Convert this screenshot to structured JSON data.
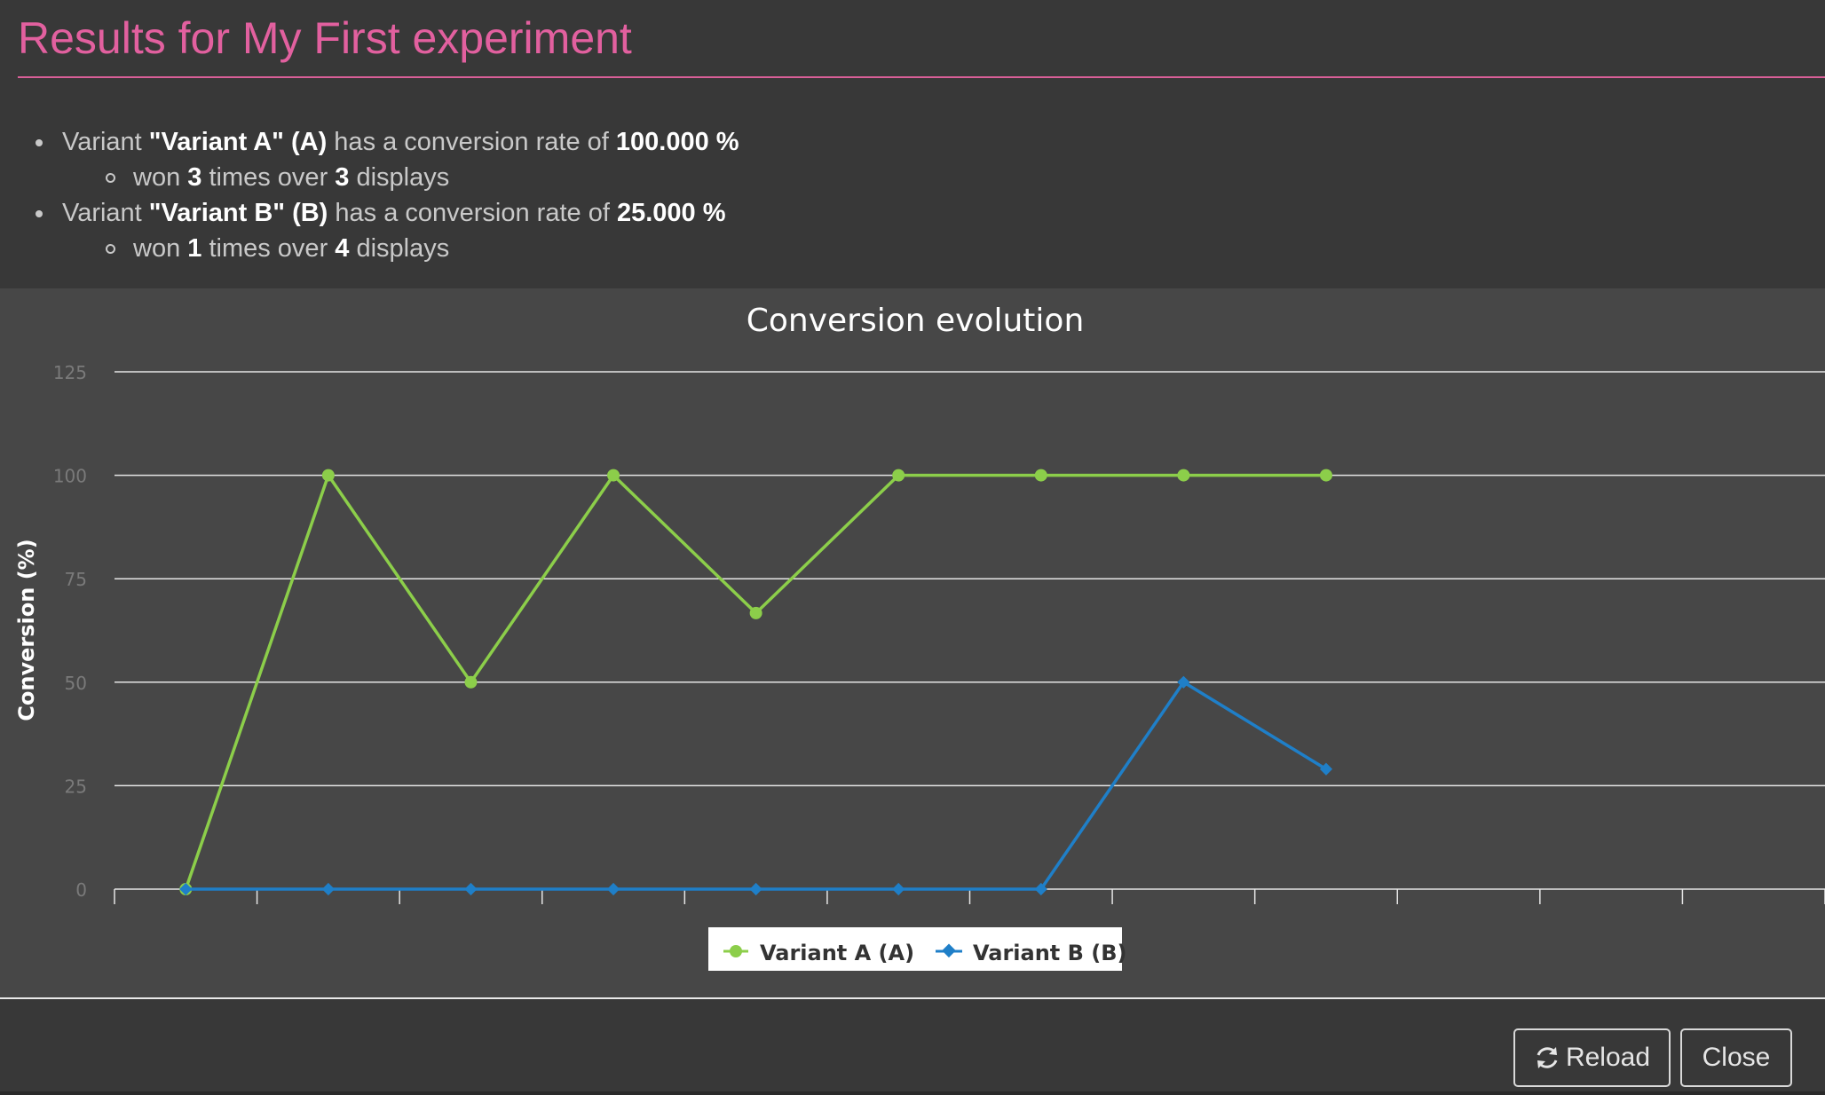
{
  "modal": {
    "title": "Results for My First experiment"
  },
  "summary": {
    "variants": [
      {
        "prefix": "Variant ",
        "name": "\"Variant A\" (A)",
        "mid": " has a conversion rate of ",
        "rate": "100.000 %",
        "won_prefix": "won ",
        "wins": "3",
        "won_mid": " times over ",
        "displays": "3",
        "won_suffix": " displays"
      },
      {
        "prefix": "Variant ",
        "name": "\"Variant B\" (B)",
        "mid": " has a conversion rate of ",
        "rate": "25.000 %",
        "won_prefix": "won ",
        "wins": "1",
        "won_mid": " times over ",
        "displays": "4",
        "won_suffix": " displays"
      }
    ]
  },
  "chart_data": {
    "type": "line",
    "title": "Conversion evolution",
    "xlabel": "",
    "ylabel": "Conversion (%)",
    "ylim": [
      0,
      125
    ],
    "yticks": [
      "0",
      "25",
      "50",
      "75",
      "100",
      "125"
    ],
    "grid": true,
    "legend_position": "bottom-center",
    "x": [
      1,
      2,
      3,
      4,
      5,
      6,
      7,
      8,
      9
    ],
    "series": [
      {
        "name": "Variant A (A)",
        "color": "#8cce4a",
        "marker": "circle",
        "values": [
          0,
          100,
          50,
          100,
          66.7,
          100,
          100,
          100,
          100
        ]
      },
      {
        "name": "Variant B (B)",
        "color": "#1f7fc8",
        "marker": "diamond",
        "values": [
          0,
          0,
          0,
          0,
          0,
          0,
          0,
          50,
          29
        ]
      }
    ]
  },
  "footer": {
    "reload_label": "Reload",
    "close_label": "Close",
    "reload_icon": "refresh-icon"
  },
  "colors": {
    "title": "#e2609f",
    "panel_bg": "#383838",
    "chart_bg": "#474747",
    "series_a": "#8cce4a",
    "series_b": "#1f7fc8"
  }
}
